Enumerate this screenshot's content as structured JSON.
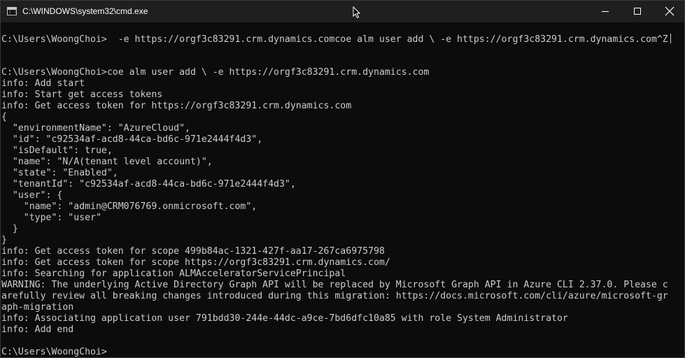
{
  "window": {
    "title": "C:\\WINDOWS\\system32\\cmd.exe",
    "icon": "cmd-icon",
    "icon_glyph": "C:\\",
    "controls": [
      "minimize-icon",
      "maximize-icon",
      "close-icon"
    ]
  },
  "terminal": {
    "lines": [
      "C:\\Users\\WoongChoi>  -e https://orgf3c83291.crm.dynamics.comcoe alm user add \\ -e https://orgf3c83291.crm.dynamics.com^Z",
      "",
      "",
      "C:\\Users\\WoongChoi>coe alm user add \\ -e https://orgf3c83291.crm.dynamics.com",
      "info: Add start",
      "info: Start get access tokens",
      "info: Get access token for https://orgf3c83291.crm.dynamics.com",
      "{",
      "  \"environmentName\": \"AzureCloud\",",
      "  \"id\": \"c92534af-acd8-44ca-bd6c-971e2444f4d3\",",
      "  \"isDefault\": true,",
      "  \"name\": \"N/A(tenant level account)\",",
      "  \"state\": \"Enabled\",",
      "  \"tenantId\": \"c92534af-acd8-44ca-bd6c-971e2444f4d3\",",
      "  \"user\": {",
      "    \"name\": \"admin@CRM076769.onmicrosoft.com\",",
      "    \"type\": \"user\"",
      "  }",
      "}",
      "info: Get access token for scope 499b84ac-1321-427f-aa17-267ca6975798",
      "info: Get access token for scope https://orgf3c83291.crm.dynamics.com/",
      "info: Searching for application ALMAcceleratorServicePrincipal",
      "WARNING: The underlying Active Directory Graph API will be replaced by Microsoft Graph API in Azure CLI 2.37.0. Please c",
      "arefully review all breaking changes introduced during this migration: https://docs.microsoft.com/cli/azure/microsoft-gr",
      "aph-migration",
      "info: Associating application user 791bdd30-244e-44dc-a9ce-7bd6dfc10a85 with role System Administrator",
      "info: Add end",
      "",
      "C:\\Users\\WoongChoi>"
    ]
  },
  "colors": {
    "background": "#0c0c0c",
    "text": "#cccccc",
    "titlebar": "#1f1f1f"
  }
}
